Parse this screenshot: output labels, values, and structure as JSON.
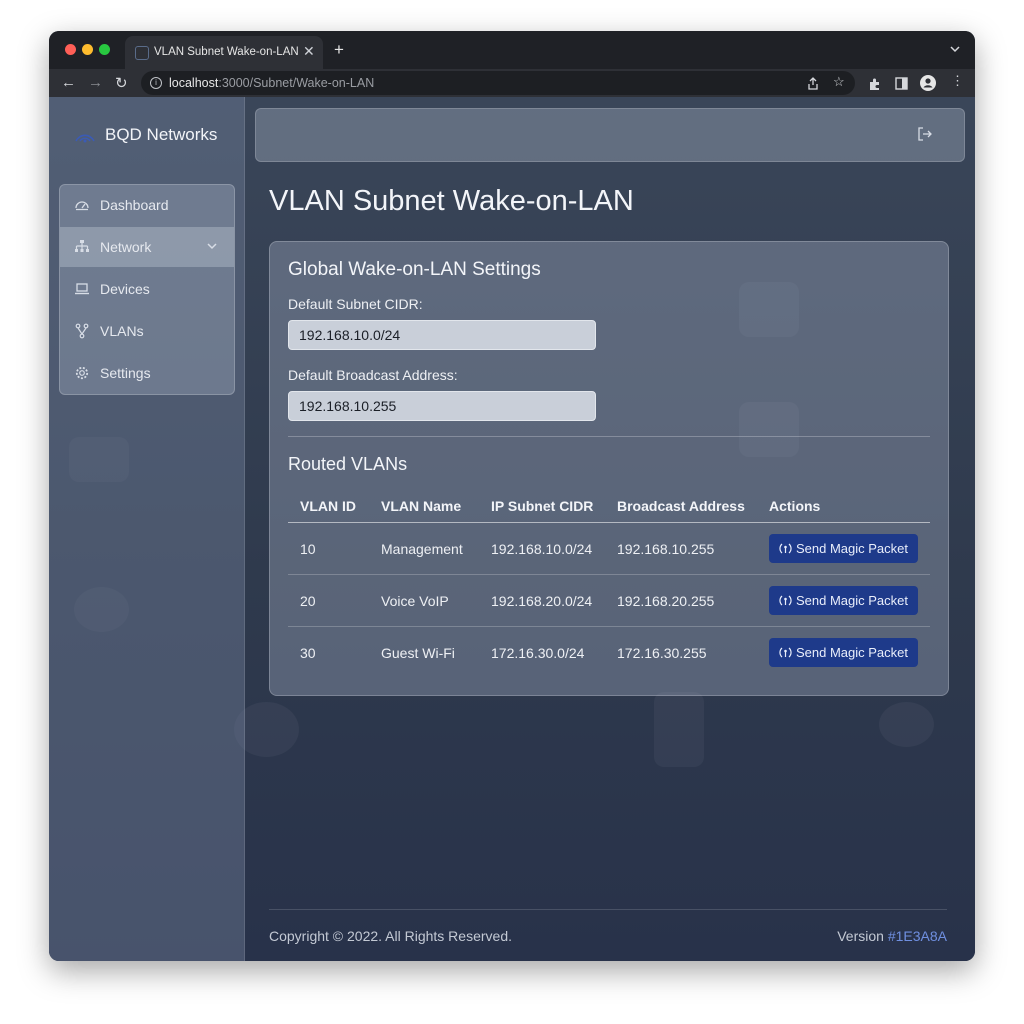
{
  "browser": {
    "tab_title": "VLAN Subnet Wake-on-LAN",
    "url_host": "localhost",
    "url_path": ":3000/Subnet/Wake-on-LAN"
  },
  "brand": {
    "name": "BQD Networks"
  },
  "sidebar": {
    "items": [
      {
        "label": "Dashboard",
        "icon": "gauge-icon"
      },
      {
        "label": "Network",
        "icon": "network-icon"
      },
      {
        "label": "Devices",
        "icon": "laptop-icon"
      },
      {
        "label": "VLANs",
        "icon": "vlan-icon"
      },
      {
        "label": "Settings",
        "icon": "gear-icon"
      }
    ],
    "active": "Network"
  },
  "page": {
    "title": "VLAN Subnet Wake-on-LAN"
  },
  "global_settings": {
    "heading": "Global Wake-on-LAN Settings",
    "subnet_label": "Default Subnet CIDR:",
    "subnet_value": "192.168.10.0/24",
    "broadcast_label": "Default Broadcast Address:",
    "broadcast_value": "192.168.10.255"
  },
  "routed_vlans": {
    "heading": "Routed VLANs",
    "columns": [
      "VLAN ID",
      "VLAN Name",
      "IP Subnet CIDR",
      "Broadcast Address",
      "Actions"
    ],
    "rows": [
      {
        "id": "10",
        "name": "Management",
        "subnet": "192.168.10.0/24",
        "broadcast": "192.168.10.255",
        "action": "Send Magic Packet"
      },
      {
        "id": "20",
        "name": "Voice VoIP",
        "subnet": "192.168.20.0/24",
        "broadcast": "192.168.20.255",
        "action": "Send Magic Packet"
      },
      {
        "id": "30",
        "name": "Guest Wi-Fi",
        "subnet": "172.16.30.0/24",
        "broadcast": "172.16.30.255",
        "action": "Send Magic Packet"
      }
    ]
  },
  "footer": {
    "copyright": "Copyright © 2022. All Rights Reserved.",
    "version_label": "Version",
    "version_value": "#1E3A8A"
  },
  "colors": {
    "accent": "#1E3A8A",
    "link": "#6F8FE0"
  }
}
